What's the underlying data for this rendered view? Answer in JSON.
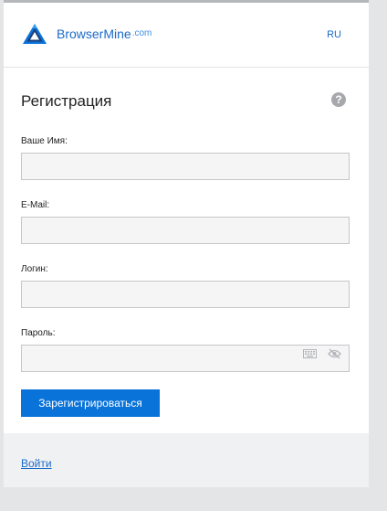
{
  "header": {
    "brand": "BrowserMine",
    "brand_suffix": ".com",
    "language": "RU"
  },
  "form": {
    "title": "Регистрация",
    "help_symbol": "?",
    "fields": [
      {
        "label": "Ваше Имя:",
        "value": "",
        "placeholder": ""
      },
      {
        "label": "E-Mail:",
        "value": "",
        "placeholder": ""
      },
      {
        "label": "Логин:",
        "value": "",
        "placeholder": ""
      },
      {
        "label": "Пароль:",
        "value": "",
        "placeholder": ""
      }
    ],
    "submit_label": "Зарегистрироваться"
  },
  "footer": {
    "login_link": "Войти"
  },
  "colors": {
    "accent": "#0a73d9",
    "link": "#1b6ac9",
    "background": "#e4e5e7",
    "footer_bg": "#f0f1f3"
  },
  "icons": {
    "logo": "browsermine-logo-icon",
    "help": "help-icon",
    "keyboard": "keyboard-icon",
    "visibility": "eye-off-icon"
  }
}
